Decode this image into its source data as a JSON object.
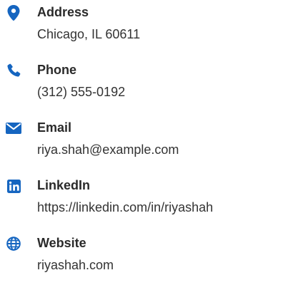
{
  "theme": {
    "accent": "#1565c0"
  },
  "contact": {
    "items": [
      {
        "icon": "map-pin-icon",
        "label": "Address",
        "value": "Chicago, IL 60611"
      },
      {
        "icon": "phone-icon",
        "label": "Phone",
        "value": "(312) 555-0192"
      },
      {
        "icon": "envelope-icon",
        "label": "Email",
        "value": "riya.shah@example.com"
      },
      {
        "icon": "linkedin-icon",
        "label": "LinkedIn",
        "value": "https://linkedin.com/in/riyashah"
      },
      {
        "icon": "globe-icon",
        "label": "Website",
        "value": "riyashah.com"
      }
    ]
  }
}
